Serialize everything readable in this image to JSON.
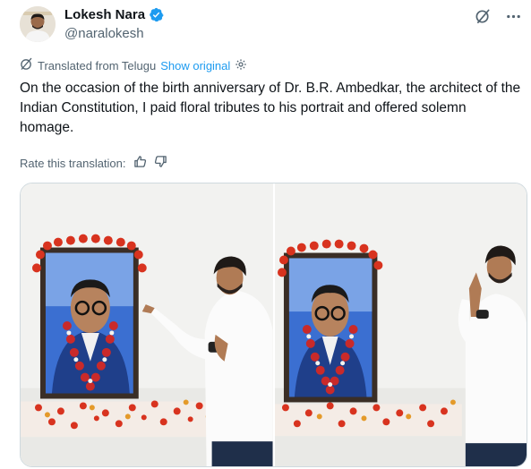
{
  "author": {
    "display_name": "Lokesh Nara",
    "handle": "@naralokesh",
    "verified": true
  },
  "icons": {
    "grok": "grok-icon",
    "more": "more-icon",
    "translate": "translate-icon",
    "settings": "settings-icon",
    "thumbs_up": "thumbs-up-icon",
    "thumbs_down": "thumbs-down-icon",
    "verified": "verified-badge-icon"
  },
  "translation": {
    "label": "Translated from Telugu",
    "show_original": "Show original"
  },
  "tweet": {
    "text": "On the occasion of the birth anniversary of Dr. B.R. Ambedkar, the architect of the Indian Constitution, I paid floral tributes to his portrait and offered solemn homage."
  },
  "rating": {
    "label": "Rate this translation:"
  },
  "colors": {
    "link": "#1d9bf0",
    "verified": "#1d9bf0",
    "secondary_text": "#536471"
  }
}
